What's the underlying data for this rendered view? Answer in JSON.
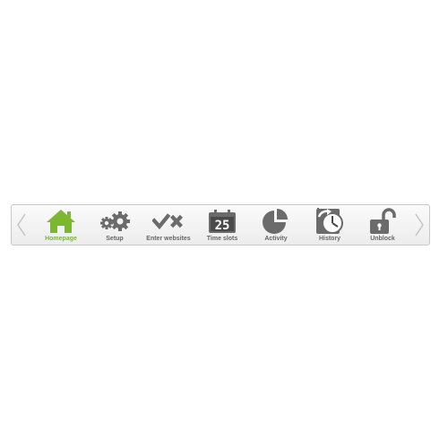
{
  "toolbar": {
    "items": [
      {
        "label": "Homepage",
        "icon": "home-icon",
        "active": true
      },
      {
        "label": "Setup",
        "icon": "gears-icon",
        "active": false
      },
      {
        "label": "Enter websites",
        "icon": "check-cross-icon",
        "active": false
      },
      {
        "label": "Time slots",
        "icon": "calendar-icon",
        "active": false,
        "icon_text": "25"
      },
      {
        "label": "Activity",
        "icon": "pie-chart-icon",
        "active": false
      },
      {
        "label": "History",
        "icon": "history-clock-icon",
        "active": false
      },
      {
        "label": "Unblock",
        "icon": "unlock-icon",
        "active": false
      }
    ]
  },
  "colors": {
    "active": "#7cb82f",
    "icon": "#6b6b6b",
    "label": "#666666",
    "arrow": "#c4c4c4"
  }
}
